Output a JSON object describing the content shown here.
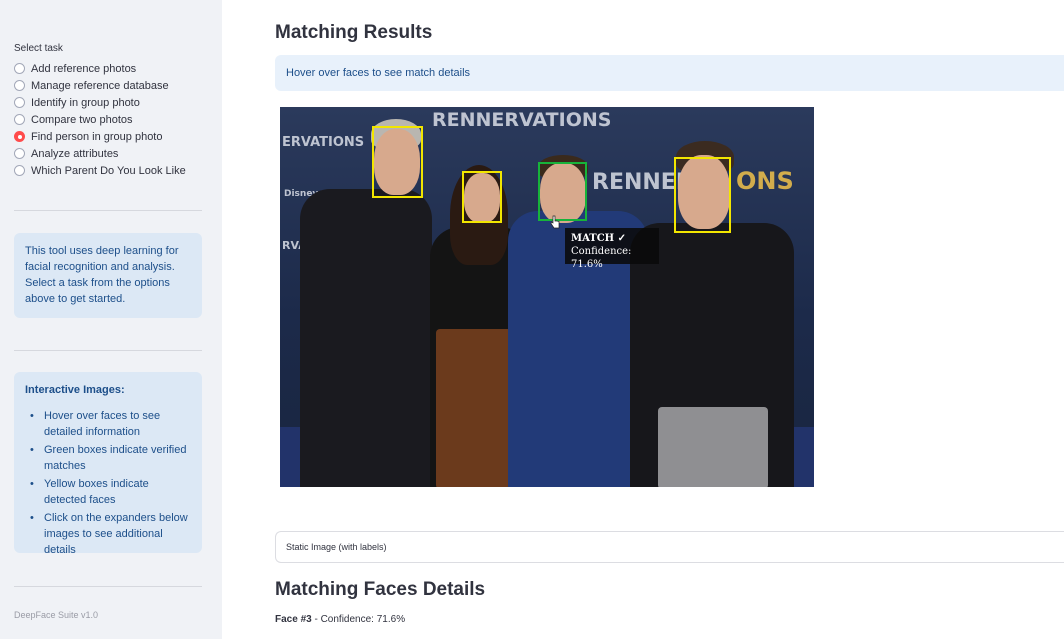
{
  "sidebar": {
    "select_label": "Select task",
    "tasks": [
      {
        "label": "Add reference photos",
        "selected": false
      },
      {
        "label": "Manage reference database",
        "selected": false
      },
      {
        "label": "Identify in group photo",
        "selected": false
      },
      {
        "label": "Compare two photos",
        "selected": false
      },
      {
        "label": "Find person in group photo",
        "selected": true
      },
      {
        "label": "Analyze attributes",
        "selected": false
      },
      {
        "label": "Which Parent Do You Look Like",
        "selected": false
      }
    ],
    "info_text": "This tool uses deep learning for facial recognition and analysis. Select a task from the options above to get started.",
    "interactive": {
      "title": "Interactive Images:",
      "items": [
        "Hover over faces to see detailed information",
        "Green boxes indicate verified matches",
        "Yellow boxes indicate detected faces",
        "Click on the expanders below images to see additional details"
      ]
    },
    "version": "DeepFace Suite v1.0"
  },
  "main": {
    "title": "Matching Results",
    "alert": "Hover over faces to see match details",
    "photo": {
      "backdrop_text": [
        "RENNERVATIONS",
        "RENNER",
        "ONS",
        "ERVATIONS",
        "Disney+",
        "RVATIONS"
      ],
      "tooltip_title": "MATCH ✓",
      "tooltip_confidence": "Confidence: 71.6%"
    },
    "expander_label": "Static Image (with labels)",
    "details_title": "Matching Faces Details",
    "face_detail": {
      "face_label": "Face #3",
      "confidence": " - Confidence: 71.6%"
    }
  },
  "colors": {
    "accent": "#ff4b4b",
    "match_box": "#17b33a",
    "detect_box": "#f2e600",
    "info_bg": "#dce8f5",
    "info_text": "#1d4f8a"
  }
}
